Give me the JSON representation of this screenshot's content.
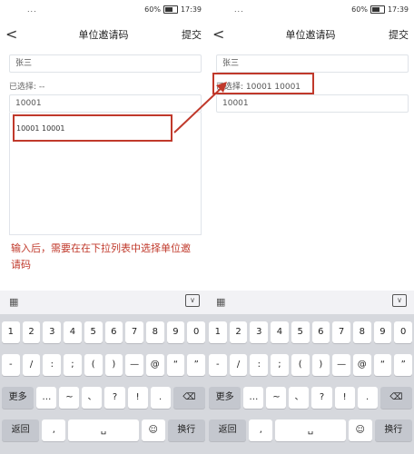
{
  "status_bar": {
    "signal": "...",
    "battery_percent": "60%",
    "time": "17:39"
  },
  "nav": {
    "back": "<",
    "title": "单位邀请码",
    "submit": "提交"
  },
  "left": {
    "name_value": "张三",
    "selected_text": "已选择: --",
    "code_value": "10001",
    "dropdown_item": "10001  10001"
  },
  "right": {
    "name_value": "张三",
    "selected_text": "已选择:  10001  10001",
    "code_value": "10001"
  },
  "note": "输入后，需要在在下拉列表中选择单位邀请码",
  "keyboard": {
    "row1": [
      "1",
      "2",
      "3",
      "4",
      "5",
      "6",
      "7",
      "8",
      "9",
      "0"
    ],
    "row2": [
      "-",
      "/",
      ":",
      ";",
      "(",
      ")",
      "—",
      "@",
      "“",
      "”"
    ],
    "row3": [
      "更多",
      "…",
      "~",
      "、",
      "?",
      "!",
      ".",
      "⌫"
    ],
    "row4": [
      "返回",
      ",",
      "␣",
      "☺",
      "换行"
    ]
  },
  "colors": {
    "annotation_red": "#c0392b"
  }
}
